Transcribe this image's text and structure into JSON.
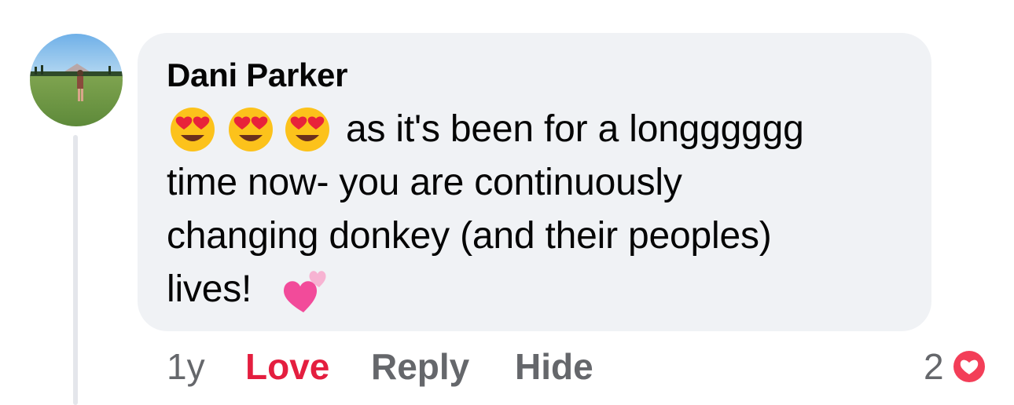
{
  "comment": {
    "author": "Dani Parker",
    "lines": [
      "as it's been for a longggggg",
      "time now- you are continuously",
      "changing donkey (and their peoples)",
      "lives!"
    ],
    "emojis": [
      "heart-eyes-emoji",
      "heart-eyes-emoji",
      "heart-eyes-emoji",
      "two-hearts-emoji"
    ]
  },
  "actions": {
    "time": "1y",
    "love_label": "Love",
    "reply_label": "Reply",
    "hide_label": "Hide"
  },
  "reactions": {
    "count": "2",
    "icon": "love-reaction-icon"
  },
  "colors": {
    "love_active": "#e41e3f",
    "secondary_text": "#65676b",
    "bubble_bg": "#f0f2f5"
  }
}
